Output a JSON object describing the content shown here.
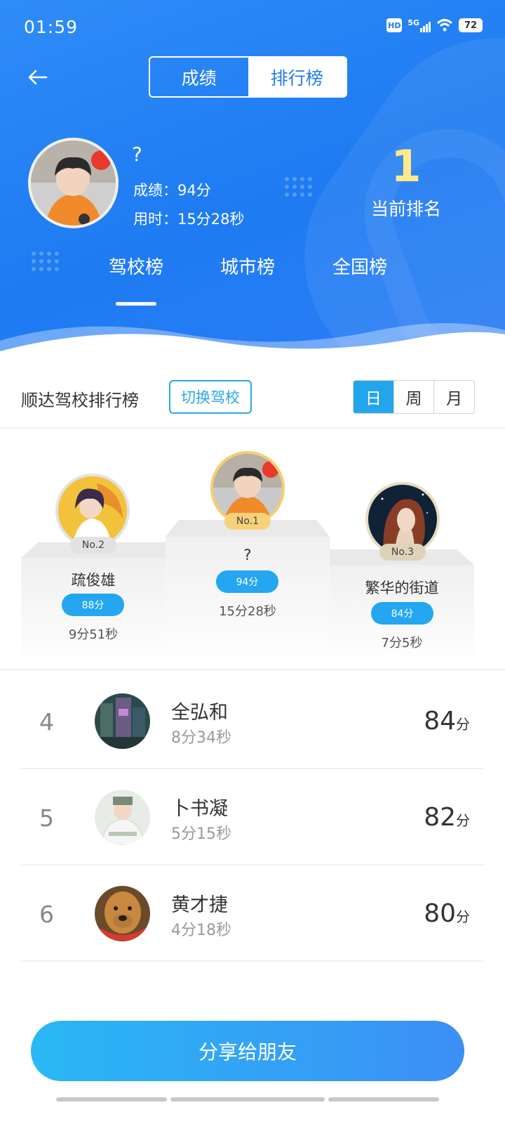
{
  "status": {
    "time": "01:59",
    "hd": "HD",
    "net": "5G",
    "battery": "72"
  },
  "header": {
    "tab_scores": "成绩",
    "tab_ranking": "排行榜"
  },
  "me": {
    "name": "?",
    "score_line": "成绩：94分",
    "time_line": "用时：15分28秒",
    "rank": "1",
    "rank_label": "当前排名"
  },
  "scope_tabs": [
    "驾校榜",
    "城市榜",
    "全国榜"
  ],
  "board": {
    "title": "顺达驾校排行榜",
    "switch_label": "切换驾校",
    "periods": [
      "日",
      "周",
      "月"
    ]
  },
  "podium": {
    "first": {
      "badge": "No.1",
      "name": "?",
      "score": "94分",
      "time": "15分28秒"
    },
    "second": {
      "badge": "No.2",
      "name": "疏俊雄",
      "score": "88分",
      "time": "9分51秒"
    },
    "third": {
      "badge": "No.3",
      "name": "繁华的街道",
      "score": "84分",
      "time": "7分5秒"
    }
  },
  "list": [
    {
      "rank": "4",
      "name": "全弘和",
      "time": "8分34秒",
      "score": "84",
      "unit": "分"
    },
    {
      "rank": "5",
      "name": "卜书凝",
      "time": "5分15秒",
      "score": "82",
      "unit": "分"
    },
    {
      "rank": "6",
      "name": "黄才捷",
      "time": "4分18秒",
      "score": "80",
      "unit": "分"
    }
  ],
  "share_label": "分享给朋友",
  "colors": {
    "primary": "#1e7bf2",
    "accent": "#23a5ec",
    "rank_gold": "#ffe98a"
  }
}
